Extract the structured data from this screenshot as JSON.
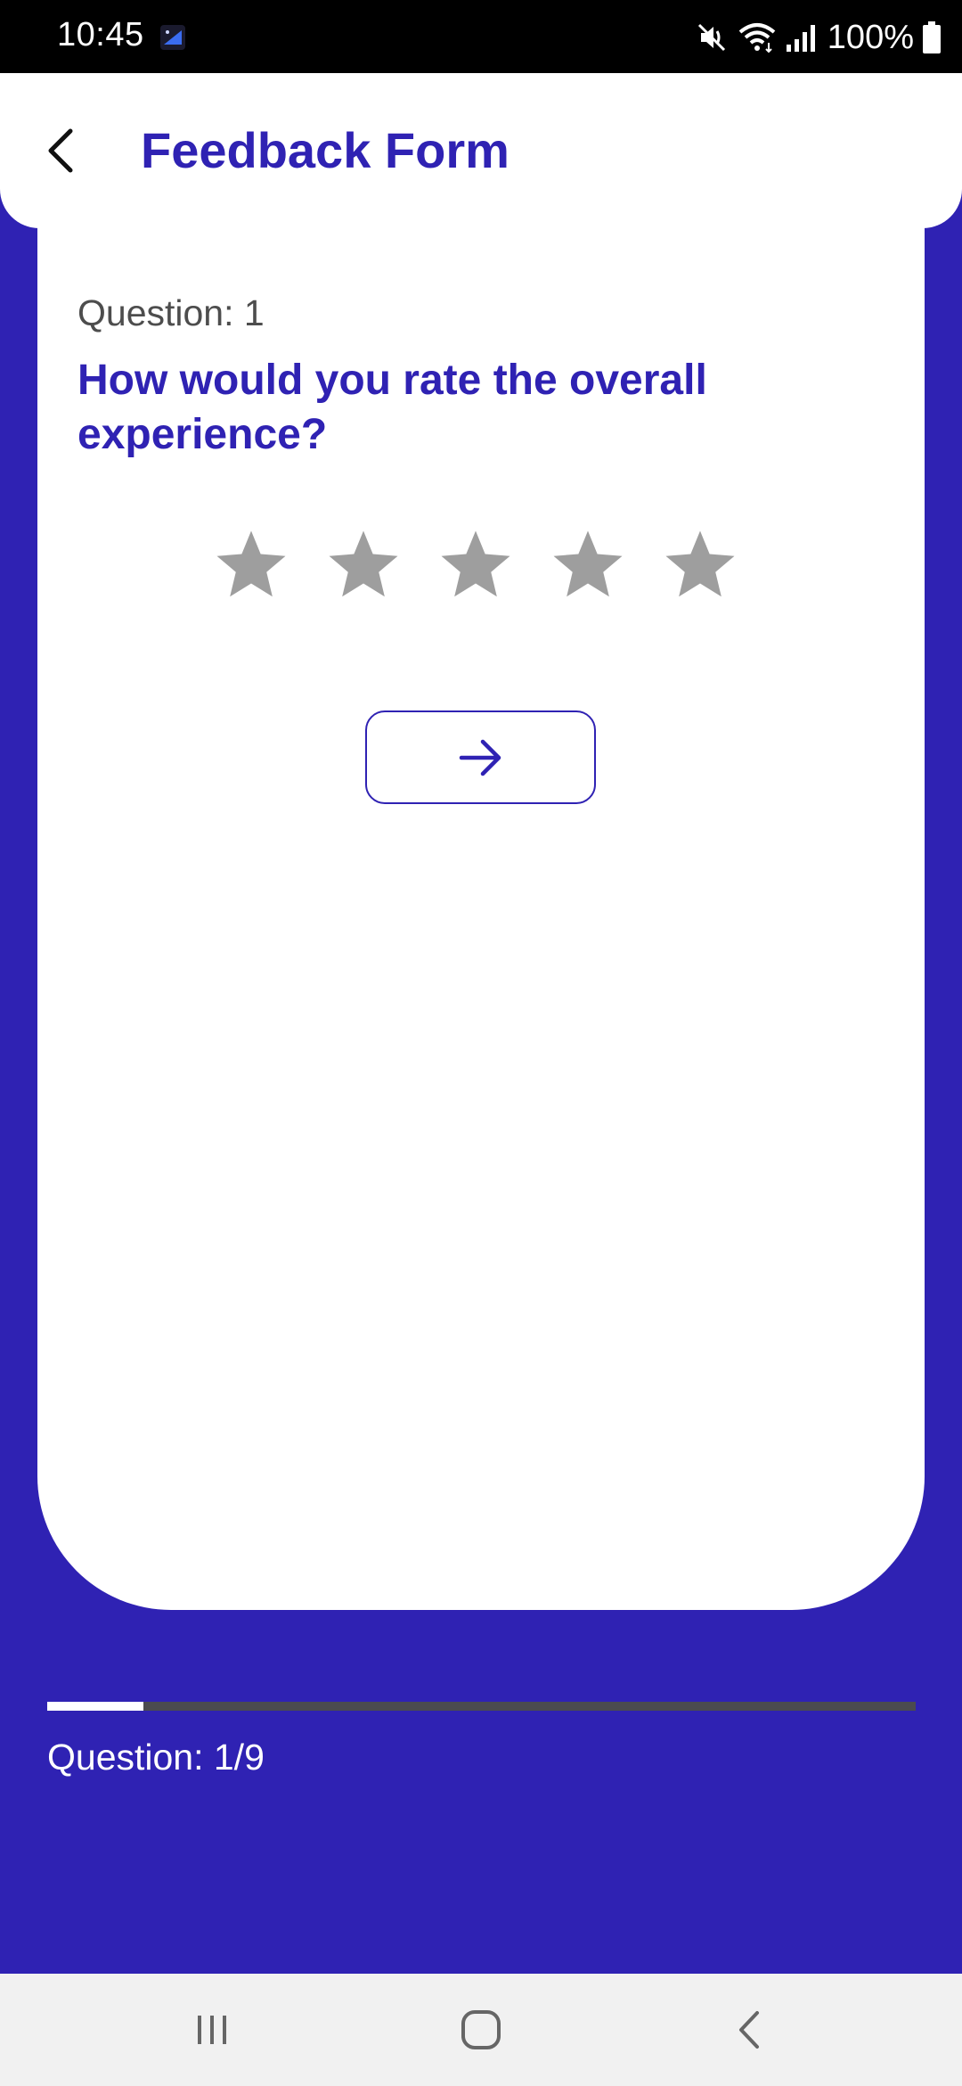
{
  "status_bar": {
    "time": "10:45",
    "battery": "100%",
    "icons": [
      "mute-icon",
      "wifi-icon",
      "signal-icon",
      "battery-icon"
    ]
  },
  "header": {
    "title": "Feedback Form",
    "back_icon": "chevron-left-icon"
  },
  "question": {
    "number_label": "Question: 1",
    "text": "How would you rate the overall experience?",
    "rating_max": 5,
    "rating_value": 0,
    "star_color": "#9e9e9e"
  },
  "next_button": {
    "icon": "arrow-right-icon"
  },
  "progress": {
    "label": "Question: 1/9",
    "current": 1,
    "total": 9
  },
  "nav_bar": {
    "buttons": [
      "recent-apps-icon",
      "home-icon",
      "back-icon"
    ]
  },
  "colors": {
    "primary": "#2f22b3",
    "surface": "#ffffff",
    "track": "#4b4b4f"
  }
}
